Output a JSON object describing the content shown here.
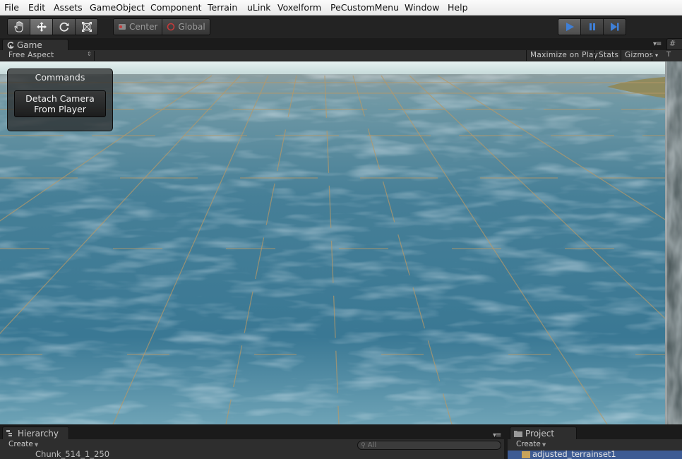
{
  "menu": [
    "File",
    "Edit",
    "Assets",
    "GameObject",
    "Component",
    "Terrain",
    "uLink",
    "Voxelform",
    "PeCustomMenu",
    "Window",
    "Help"
  ],
  "toolbar": {
    "transform_tools": [
      "hand-tool-icon",
      "move-tool-icon",
      "rotate-tool-icon",
      "scale-tool-icon"
    ],
    "pivot_mode": "Center",
    "pivot_rotation": "Global",
    "playback": [
      "play-icon",
      "pause-icon",
      "step-icon"
    ],
    "playing": true
  },
  "game_view": {
    "tab_label": "Game",
    "aspect": "Free Aspect",
    "maximize_on_play": "Maximize on Play",
    "stats": "Stats",
    "gizmos": "Gizmos",
    "commands": {
      "title": "Commands",
      "detach_line1": "Detach Camera",
      "detach_line2": "From Player"
    }
  },
  "right_panel": {
    "tab_label": "T"
  },
  "hierarchy": {
    "tab_label": "Hierarchy",
    "create_label": "Create",
    "search_placeholder": "All",
    "visible_item": "Chunk_514_1_250"
  },
  "project": {
    "tab_label": "Project",
    "create_label": "Create",
    "visible_item": "adjusted_terrainset1"
  },
  "colors": {
    "menu_bar": "#f2f2f2",
    "editor_dark": "#1b1b1b",
    "panel": "#2e2e2e",
    "play_active": "#3f7fd6",
    "water": "#3f7f96",
    "selection": "#3d5b93"
  }
}
